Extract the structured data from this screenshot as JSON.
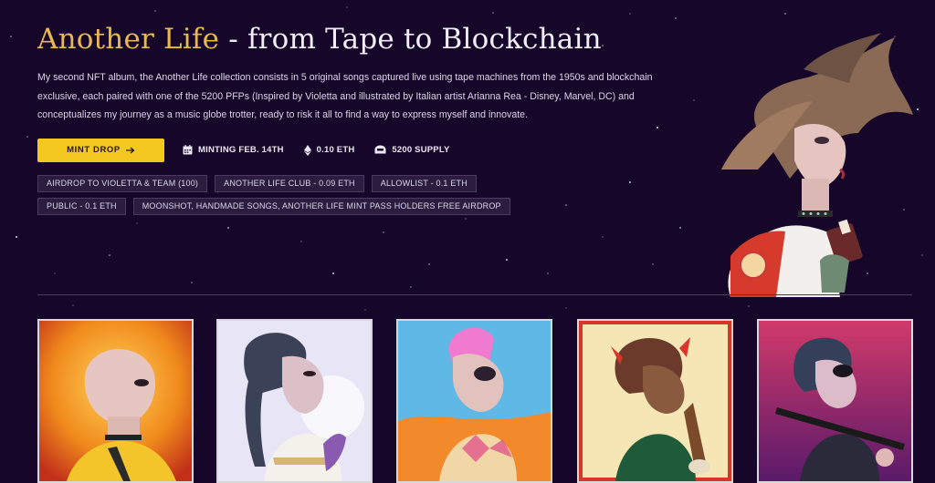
{
  "title_part1": "Another Life",
  "title_part2": " - from Tape to Blockchain",
  "description": "My second NFT album, the Another Life collection consists in 5 original songs captured live using tape machines from the 1950s and blockchain exclusive, each paired with one of the 5200 PFPs (Inspired by Violetta and illustrated by Italian artist Arianna Rea - Disney, Marvel, DC) and conceptualizes my journey as a music globe trotter, ready to risk it all to find a way to express myself and innovate.",
  "mint_button": "MINT DROP",
  "stats": {
    "date": "MINTING FEB. 14TH",
    "price": "0.10 ETH",
    "supply": "5200 SUPPLY"
  },
  "tags": [
    "AIRDROP TO VIOLETTA & TEAM (100)",
    "ANOTHER LIFE CLUB - 0.09 ETH",
    "ALLOWLIST - 0.1 ETH",
    "PUBLIC - 0.1 ETH",
    "MOONSHOT, HANDMADE SONGS, ANOTHER LIFE MINT PASS HOLDERS FREE AIRDROP"
  ],
  "colors": {
    "background": "#16062a",
    "accent_gold": "#e8b94c",
    "button_yellow": "#f4c81f",
    "tag_bg": "#2b1c40"
  },
  "icons": {
    "date": "calendar-icon",
    "price": "ethereum-icon",
    "supply": "supply-icon",
    "button": "arrow-right-icon"
  }
}
